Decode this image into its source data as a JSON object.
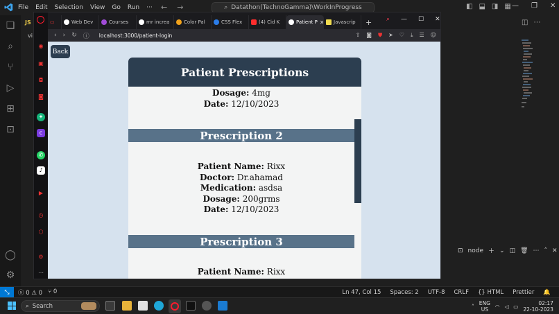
{
  "vscode": {
    "menu": [
      "File",
      "Edit",
      "Selection",
      "View",
      "Go",
      "Run",
      "···"
    ],
    "command_center": "Datathon(TechnoGamma)\\WorkInProgress",
    "panel_terminal_label": "node",
    "status_left": {
      "errors": "0",
      "warnings": "0",
      "ports": "0"
    },
    "status_right": [
      "Ln 47, Col 15",
      "Spaces: 2",
      "UTF-8",
      "CRLF",
      "{} HTML",
      "Prettier"
    ],
    "sidebar_js_label": "JS",
    "sidebar_vi_label": "vi"
  },
  "browser": {
    "tabs": [
      {
        "label": "Web Dev",
        "color": "#ffffff"
      },
      {
        "label": "Courses",
        "color": "#a04bd6"
      },
      {
        "label": "mr increa",
        "color": "#ffffff"
      },
      {
        "label": "Color Pal",
        "color": "#f1a21b"
      },
      {
        "label": "CSS Flex",
        "color": "#2b7de9"
      },
      {
        "label": "(4) Cid K",
        "color": "#ff2d2d"
      },
      {
        "label": "Patient P",
        "color": "#ffffff",
        "active": true
      },
      {
        "label": "Javascrip",
        "color": "#f0db4f"
      }
    ],
    "url": "localhost:3000/patient-login"
  },
  "page": {
    "back_label": "Back",
    "title": "Patient Prescriptions",
    "partial_prescription": {
      "dosage_label": "Dosage:",
      "dosage": "4mg",
      "date_label": "Date:",
      "date": "12/10/2023"
    },
    "prescriptions": [
      {
        "heading": "Prescription 2",
        "patient_label": "Patient Name:",
        "patient": "Rixx",
        "doctor_label": "Doctor:",
        "doctor": "Dr.ahamad",
        "medication_label": "Medication:",
        "medication": "asdsa",
        "dosage_label": "Dosage:",
        "dosage": "200grms",
        "date_label": "Date:",
        "date": "12/10/2023"
      },
      {
        "heading": "Prescription 3",
        "patient_label": "Patient Name:",
        "patient": "Rixx"
      }
    ]
  },
  "taskbar": {
    "search_label": "Search",
    "language": "ENG",
    "region": "US",
    "time": "02:17",
    "date": "22-10-2023"
  }
}
